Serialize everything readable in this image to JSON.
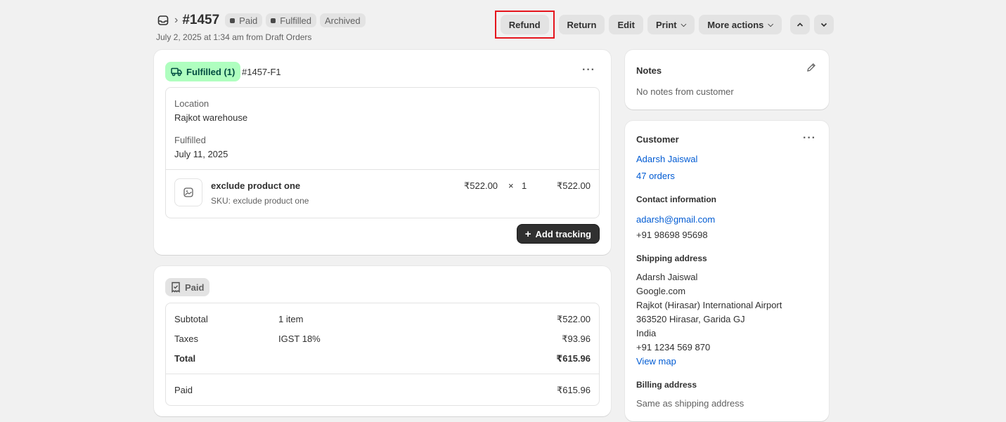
{
  "header": {
    "order_number": "#1457",
    "badges": [
      "Paid",
      "Fulfilled",
      "Archived"
    ],
    "subtitle": "July 2, 2025 at 1:34 am from Draft Orders",
    "actions": {
      "refund": "Refund",
      "return": "Return",
      "edit": "Edit",
      "print": "Print",
      "more": "More actions"
    }
  },
  "fulfillment": {
    "badge": "Fulfilled (1)",
    "id": "#1457-F1",
    "location_label": "Location",
    "location_value": "Rajkot warehouse",
    "fulfilled_label": "Fulfilled",
    "fulfilled_date": "July 11, 2025",
    "product": {
      "name": "exclude product one",
      "sku": "SKU: exclude product one",
      "price": "₹522.00",
      "times": "×",
      "qty": "1",
      "total": "₹522.00"
    },
    "add_tracking": "Add tracking"
  },
  "payment": {
    "badge": "Paid",
    "rows": {
      "subtotal": {
        "label": "Subtotal",
        "detail": "1 item",
        "amount": "₹522.00"
      },
      "taxes": {
        "label": "Taxes",
        "detail": "IGST 18%",
        "amount": "₹93.96"
      },
      "total": {
        "label": "Total",
        "amount": "₹615.96"
      },
      "paid": {
        "label": "Paid",
        "amount": "₹615.96"
      }
    }
  },
  "notes": {
    "title": "Notes",
    "text": "No notes from customer"
  },
  "customer": {
    "title": "Customer",
    "name": "Adarsh Jaiswal",
    "orders": "47 orders",
    "contact_title": "Contact information",
    "email": "adarsh@gmail.com",
    "phone": "+91 98698 95698",
    "shipping_title": "Shipping address",
    "shipping_lines": [
      "Adarsh Jaiswal",
      "Google.com",
      "Rajkot (Hirasar) International Airport",
      "363520 Hirasar, Garida GJ",
      "India",
      "+91 1234 569 870"
    ],
    "view_map": "View map",
    "billing_title": "Billing address",
    "billing_text": "Same as shipping address"
  },
  "colors": {
    "highlight": "#e5141c",
    "fulfilled_badge": "#affebf",
    "link": "#005bd3"
  }
}
